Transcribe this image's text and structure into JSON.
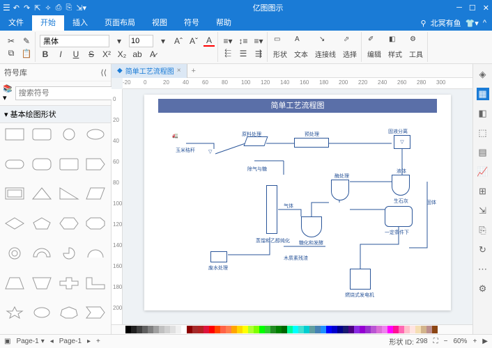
{
  "app": {
    "title": "亿图图示"
  },
  "menubar": {
    "tabs": [
      "文件",
      "开始",
      "插入",
      "页面布局",
      "视图",
      "符号",
      "帮助"
    ],
    "active": 1,
    "user": "北冥有鱼"
  },
  "ribbon": {
    "font_name": "黑体",
    "font_size": "10",
    "groups": {
      "shape": "形状",
      "text": "文本",
      "connector": "连接线",
      "select": "选择",
      "edit": "编辑",
      "style": "样式",
      "tools": "工具"
    }
  },
  "left": {
    "title": "符号库",
    "search_placeholder": "搜索符号",
    "category": "基本绘图形状"
  },
  "doc": {
    "tab_title": "简单工艺流程图"
  },
  "ruler_h": [
    "-20",
    "0",
    "20",
    "40",
    "60",
    "80",
    "100",
    "120",
    "140",
    "160",
    "180",
    "200",
    "220",
    "240",
    "260",
    "280",
    "300"
  ],
  "ruler_v": [
    "0",
    "20",
    "40",
    "60",
    "80",
    "100",
    "120",
    "140",
    "160",
    "180",
    "200"
  ],
  "diagram": {
    "title": "简单工艺流程图",
    "labels": {
      "corn": "玉米秸秆",
      "raw": "原料处理",
      "pretreat": "预处理",
      "solidliquid": "固液分离",
      "liquid": "液体",
      "solid": "固体",
      "degas": "除气与糖",
      "enzyme": "酶处理",
      "biomass": "生石灰",
      "gas": "气体",
      "distill": "蒸馏和乙醇纯化",
      "saccharify": "糖化和发酵",
      "condition": "一定条件下",
      "waste": "废水处理",
      "lignin": "木质素残渣",
      "generator": "燃烧式发电机"
    }
  },
  "colors": [
    "#000000",
    "#202020",
    "#404040",
    "#606060",
    "#808080",
    "#a0a0a0",
    "#c0c0c0",
    "#d0d0d0",
    "#e0e0e0",
    "#f0f0f0",
    "#ffffff",
    "#8b0000",
    "#a52a2a",
    "#b22222",
    "#dc143c",
    "#ff0000",
    "#ff4500",
    "#ff6347",
    "#ff7f50",
    "#ffa500",
    "#ffd700",
    "#ffff00",
    "#adff2f",
    "#7fff00",
    "#00ff00",
    "#32cd32",
    "#228b22",
    "#008000",
    "#006400",
    "#00fa9a",
    "#00ffff",
    "#40e0d0",
    "#00ced1",
    "#5f9ea0",
    "#4682b4",
    "#1e90ff",
    "#0000ff",
    "#0000cd",
    "#00008b",
    "#191970",
    "#4b0082",
    "#8a2be2",
    "#9400d3",
    "#9932cc",
    "#ba55d3",
    "#da70d6",
    "#ee82ee",
    "#ff00ff",
    "#ff1493",
    "#ff69b4",
    "#ffc0cb",
    "#ffe4e1",
    "#f5deb3",
    "#d2b48c",
    "#bc8f8f",
    "#8b4513"
  ],
  "status": {
    "page_selector": "Page-1",
    "page_label": "Page-1",
    "shape_id_label": "形状 ID:",
    "shape_id": "298",
    "zoom": "60%"
  }
}
